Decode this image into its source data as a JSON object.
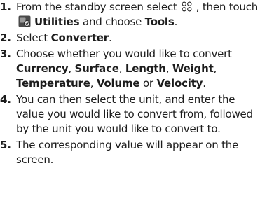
{
  "steps": [
    {
      "num": "1.",
      "t1": "From the standby screen select ",
      "menu_icon": "grid-menu-icon",
      "t2": " , then touch ",
      "utilities_icon": "utilities-icon",
      "utilities": "Utilities",
      "t3": " and choose ",
      "tools": "Tools",
      "t4": "."
    },
    {
      "num": "2.",
      "t1": "Select ",
      "converter": "Converter",
      "t2": "."
    },
    {
      "num": "3.",
      "t1": "Choose whether you would like to convert ",
      "currency": "Currency",
      "c1": ", ",
      "surface": "Surface",
      "c2": ", ",
      "length": "Length",
      "c3": ", ",
      "weight": "Weight",
      "c4": ", ",
      "temperature": "Temperature",
      "c5": ", ",
      "volume": "Volume",
      "or": " or ",
      "velocity": "Velocity",
      "end": "."
    },
    {
      "num": "4.",
      "text": "You can then select the unit, and enter the value you would like to convert from, followed by the unit you would like to convert to."
    },
    {
      "num": "5.",
      "text": "The corresponding value will appear on the screen."
    }
  ]
}
